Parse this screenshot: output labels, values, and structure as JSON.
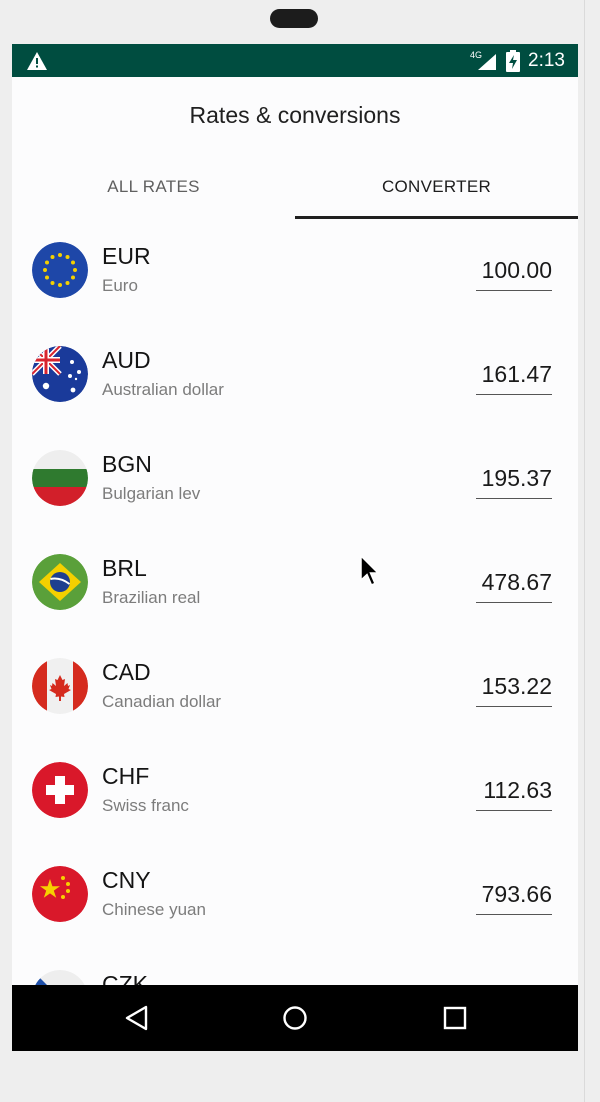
{
  "status_bar": {
    "network": "4G",
    "time": "2:13",
    "icons": [
      "warning-icon",
      "signal-icon",
      "battery-charging-icon"
    ],
    "color": "#004d40"
  },
  "app": {
    "title": "Rates & conversions"
  },
  "tabs": [
    {
      "label": "ALL RATES",
      "selected": false
    },
    {
      "label": "CONVERTER",
      "selected": true
    }
  ],
  "currencies": [
    {
      "code": "EUR",
      "name": "Euro",
      "amount": "100.00",
      "flag_icon": "eu-flag-icon"
    },
    {
      "code": "AUD",
      "name": "Australian dollar",
      "amount": "161.47",
      "flag_icon": "australia-flag-icon"
    },
    {
      "code": "BGN",
      "name": "Bulgarian lev",
      "amount": "195.37",
      "flag_icon": "bulgaria-flag-icon"
    },
    {
      "code": "BRL",
      "name": "Brazilian real",
      "amount": "478.67",
      "flag_icon": "brazil-flag-icon"
    },
    {
      "code": "CAD",
      "name": "Canadian dollar",
      "amount": "153.22",
      "flag_icon": "canada-flag-icon"
    },
    {
      "code": "CHF",
      "name": "Swiss franc",
      "amount": "112.63",
      "flag_icon": "switzerland-flag-icon"
    },
    {
      "code": "CNY",
      "name": "Chinese yuan",
      "amount": "793.66",
      "flag_icon": "china-flag-icon"
    },
    {
      "code": "CZK",
      "name": "",
      "amount": "",
      "flag_icon": "czech-flag-icon"
    }
  ],
  "nav": {
    "icons": [
      "back-icon",
      "home-icon",
      "recents-icon"
    ]
  }
}
